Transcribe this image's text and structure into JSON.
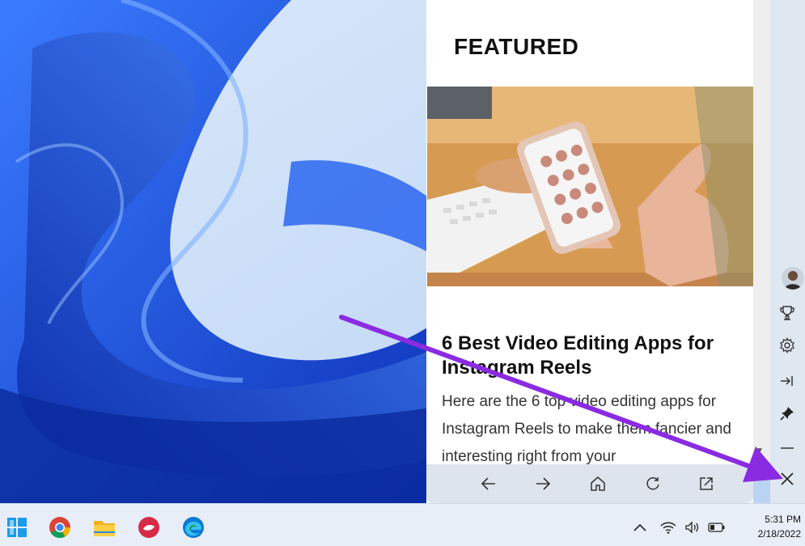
{
  "panel": {
    "heading": "FEATURED",
    "article": {
      "title": "6 Best Video Editing Apps for Instagram Reels",
      "excerpt": "Here are the 6 top video editing apps for Instagram Reels to make them fancier and interesting right from your"
    }
  },
  "panel_nav": {
    "icons": [
      "back-arrow-icon",
      "forward-arrow-icon",
      "home-icon",
      "refresh-icon",
      "open-in-new-tab-icon"
    ]
  },
  "rail": {
    "icons": [
      "avatar",
      "trophy-icon",
      "gear-icon",
      "move-to-side-icon",
      "pin-icon",
      "minimize-icon",
      "close-icon"
    ]
  },
  "taskbar": {
    "apps": [
      "windows-start-icon",
      "chrome-icon",
      "file-explorer-icon",
      "pdf-app-icon",
      "edge-icon"
    ],
    "tray": [
      "chevron-up-icon",
      "wifi-icon",
      "volume-icon",
      "battery-icon"
    ],
    "time": "5:31 PM",
    "date": "2/18/2022"
  },
  "colors": {
    "wallpaper_blue": "#1f55e0",
    "annotation_arrow": "#8a2be2",
    "edge_blue": "#0c7bd6"
  }
}
